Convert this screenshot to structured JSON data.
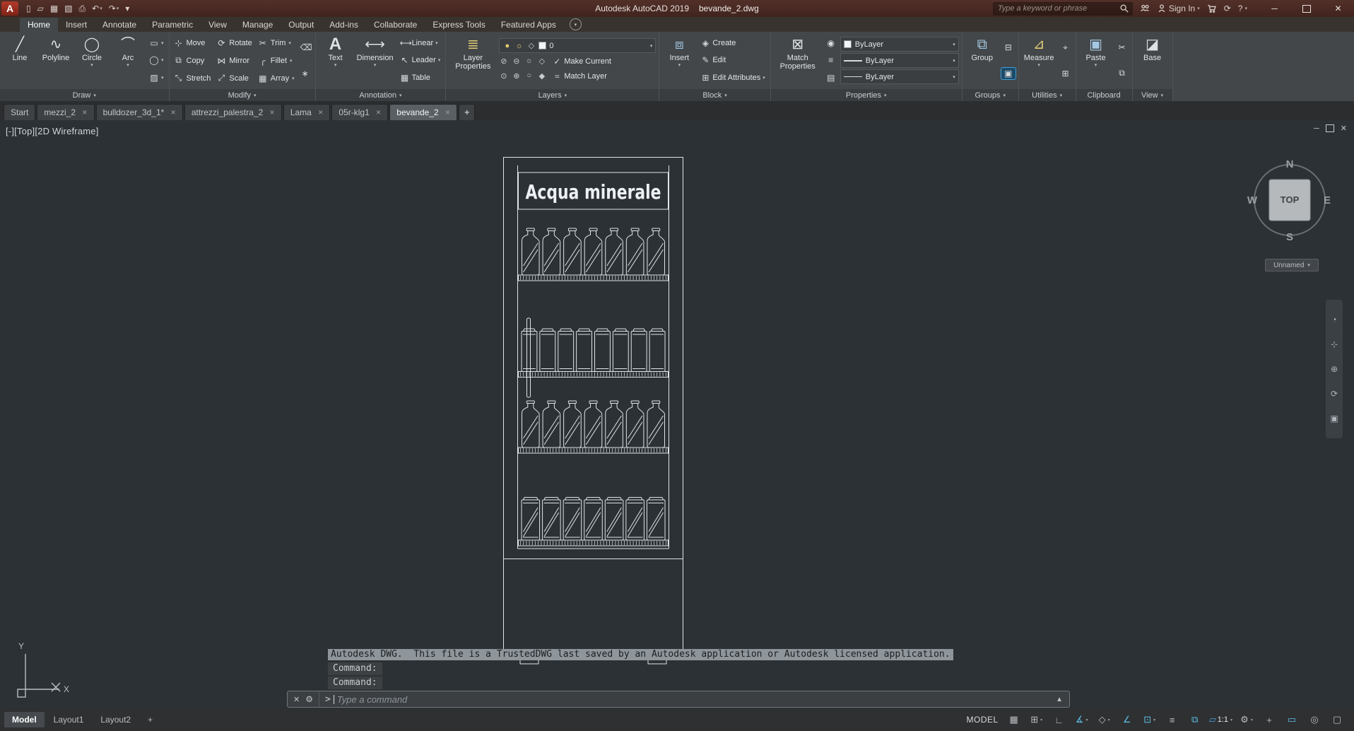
{
  "colors": {
    "titlebar": "#4c2a23",
    "ribbon": "#43474a",
    "canvas": "#2c3136",
    "accent_cyan": "#5fc0ea",
    "accent_blue": "#4da3dc",
    "line": "#dfe4e8",
    "message_highlight": "#8f969b"
  },
  "title_bar": {
    "app_title": "Autodesk AutoCAD 2019",
    "doc_title": "bevande_2.dwg",
    "search_placeholder": "Type a keyword or phrase",
    "sign_in_label": "Sign In",
    "help_label": "?",
    "qat": [
      {
        "name": "new-file-button",
        "glyph": "▯"
      },
      {
        "name": "open-file-button",
        "glyph": "▱"
      },
      {
        "name": "save-button",
        "glyph": "▦"
      },
      {
        "name": "save-as-button",
        "glyph": "▧"
      },
      {
        "name": "plot-button",
        "glyph": "⎙"
      },
      {
        "name": "undo-button",
        "glyph": "↶",
        "caret": true
      },
      {
        "name": "redo-button",
        "glyph": "↷",
        "caret": true
      },
      {
        "name": "qat-menu-button",
        "glyph": "▾"
      }
    ]
  },
  "ribbon": {
    "tabs": [
      {
        "label": "Home",
        "active": true
      },
      {
        "label": "Insert"
      },
      {
        "label": "Annotate"
      },
      {
        "label": "Parametric"
      },
      {
        "label": "View"
      },
      {
        "label": "Manage"
      },
      {
        "label": "Output"
      },
      {
        "label": "Add-ins"
      },
      {
        "label": "Collaborate"
      },
      {
        "label": "Express Tools"
      },
      {
        "label": "Featured Apps"
      }
    ],
    "panels": {
      "draw": {
        "label": "Draw",
        "big": [
          "Line",
          "Polyline",
          "Circle",
          "Arc"
        ]
      },
      "modify": {
        "label": "Modify",
        "grid": [
          "Move",
          "Rotate",
          "Trim",
          "Copy",
          "Mirror",
          "Fillet",
          "Stretch",
          "Scale",
          "Array"
        ]
      },
      "annotation": {
        "label": "Annotation",
        "big": [
          "Text",
          "Dimension"
        ],
        "small": [
          "Linear",
          "Leader",
          "Table"
        ]
      },
      "layers": {
        "label": "Layers",
        "big": "Layer Properties",
        "current_layer": "0",
        "actions": [
          "Make Current",
          "Match Layer"
        ],
        "mini1": [
          {
            "name": "layer-isolate-icon",
            "glyph": "⊘"
          },
          {
            "name": "layer-off-icon",
            "glyph": "⊖"
          },
          {
            "name": "layer-freeze-icon",
            "glyph": "☼"
          },
          {
            "name": "layer-lock-icon",
            "glyph": "◇"
          }
        ],
        "mini2": [
          {
            "name": "layer-unisolate-icon",
            "glyph": "⊙"
          },
          {
            "name": "layer-on-icon",
            "glyph": "⊕"
          },
          {
            "name": "layer-thaw-icon",
            "glyph": "○"
          },
          {
            "name": "layer-unlock-icon",
            "glyph": "◆"
          }
        ]
      },
      "block": {
        "label": "Block",
        "big": "Insert",
        "small": [
          "Create",
          "Edit",
          "Edit Attributes"
        ]
      },
      "properties": {
        "label": "Properties",
        "big": "Match Properties",
        "color_value": "ByLayer",
        "linetype_value": "ByLayer",
        "lineweight_value": "ByLayer"
      },
      "groups": {
        "label": "Groups",
        "big": "Group"
      },
      "utilities": {
        "label": "Utilities",
        "big": "Measure"
      },
      "clipboard": {
        "label": "Clipboard",
        "big": "Paste"
      },
      "view": {
        "label": "View",
        "big": "Base"
      }
    }
  },
  "icons": {
    "line": "╱",
    "polyline": "∿",
    "circle": "◯",
    "arc": "⌒",
    "rectangle": "▭",
    "ellipse": "◯",
    "hatch": "▨",
    "move": "⊹",
    "rotate": "⟳",
    "trim": "✂",
    "copy": "⧉",
    "mirror": "⋈",
    "fillet": "╭",
    "stretch": "⤡",
    "scale": "⤢",
    "array": "▦",
    "erase": "⌫",
    "explode": "∗",
    "text": "A",
    "dimension": "⟷",
    "linear": "⟷",
    "leader": "↖",
    "table": "▦",
    "layer_props": "≣",
    "make_current": "✓",
    "match_layer": "≈",
    "insert": "⧈",
    "create": "◈",
    "edit": "✎",
    "edit_attr": "⊞",
    "match_props": "⊠",
    "colorwheel": "◉",
    "prop_list": "≡",
    "prop_sheet": "▤",
    "group": "⧉",
    "ungroup": "⊟",
    "group_selection": "▣",
    "measure": "⊿",
    "id_point": "⌖",
    "quick_calc": "⊞",
    "paste": "▣",
    "cut": "✂",
    "base": "◪"
  },
  "file_tabs": [
    {
      "label": "Start",
      "close": false
    },
    {
      "label": "mezzi_2",
      "close": true
    },
    {
      "label": "bulldozer_3d_1*",
      "close": true
    },
    {
      "label": "attrezzi_palestra_2",
      "close": true
    },
    {
      "label": "Lama",
      "close": true
    },
    {
      "label": "05r-klg1",
      "close": true
    },
    {
      "label": "bevande_2",
      "active": true,
      "close": true
    },
    {
      "label": "+",
      "plus": true
    }
  ],
  "canvas": {
    "viewport_label": "[-][Top][2D Wireframe]",
    "viewcube": {
      "n": "N",
      "w": "W",
      "e": "E",
      "s": "S",
      "top": "TOP"
    },
    "nav_unnamed": "Unnamed",
    "navbar": [
      {
        "name": "navigation-wheel-icon",
        "glyph": "◔"
      },
      {
        "name": "pan-icon",
        "glyph": "⊹"
      },
      {
        "name": "zoom-icon",
        "glyph": "⊕"
      },
      {
        "name": "orbit-icon",
        "glyph": "⟳"
      },
      {
        "name": "showmotion-icon",
        "glyph": "▣"
      }
    ],
    "drawing": {
      "sign_text": "Acqua minerale",
      "shelves": [
        {
          "item": "bottle",
          "count": 7,
          "hatched": true
        },
        {
          "item": "can",
          "count": 8,
          "hatched": false
        },
        {
          "item": "bottle",
          "count": 7,
          "hatched": true
        },
        {
          "item": "can",
          "count": 7,
          "hatched": true
        }
      ]
    }
  },
  "command": {
    "message": "Autodesk DWG.  This file is a TrustedDWG last saved by an Autodesk application or Autodesk licensed application.",
    "prompt1": "Command:",
    "prompt2": "Command:",
    "input_placeholder": "Type a command"
  },
  "status_bar": {
    "model_label": "MODEL",
    "layout_tabs": [
      {
        "label": "Model",
        "active": true
      },
      {
        "label": "Layout1"
      },
      {
        "label": "Layout2"
      },
      {
        "label": "+",
        "plus": true
      }
    ],
    "right": [
      {
        "name": "grid-display-button",
        "glyph": "▦",
        "color": "gray"
      },
      {
        "name": "snap-mode-button",
        "glyph": "⊞",
        "color": "gray",
        "caret": true
      },
      {
        "name": "ortho-mode-button",
        "glyph": "∟",
        "color": "gray"
      },
      {
        "name": "polar-tracking-button",
        "glyph": "∡",
        "color": "cyan",
        "caret": true
      },
      {
        "name": "isodraft-button",
        "glyph": "◇",
        "color": "gray",
        "caret": true
      },
      {
        "name": "object-snap-tracking-button",
        "glyph": "∠",
        "color": "cyan"
      },
      {
        "name": "object-snap-button",
        "glyph": "⊡",
        "color": "cyan",
        "caret": true
      },
      {
        "name": "lineweight-button",
        "glyph": "≡",
        "color": "gray"
      },
      {
        "name": "selection-cycling-button",
        "glyph": "⧉",
        "color": "cyan"
      },
      {
        "name": "annotation-scale-button",
        "glyph": "▱",
        "text": "1:1",
        "color": "blue",
        "caret": true
      },
      {
        "name": "workspace-switching-button",
        "glyph": "⚙",
        "color": "gray",
        "caret": true
      },
      {
        "name": "annotation-monitor-button",
        "glyph": "+",
        "color": "gray"
      },
      {
        "name": "graphics-performance-button",
        "glyph": "▭",
        "color": "cyan"
      },
      {
        "name": "isolate-objects-button",
        "glyph": "◎",
        "color": "gray"
      },
      {
        "name": "clean-screen-button",
        "glyph": "▢",
        "color": "gray"
      }
    ]
  }
}
